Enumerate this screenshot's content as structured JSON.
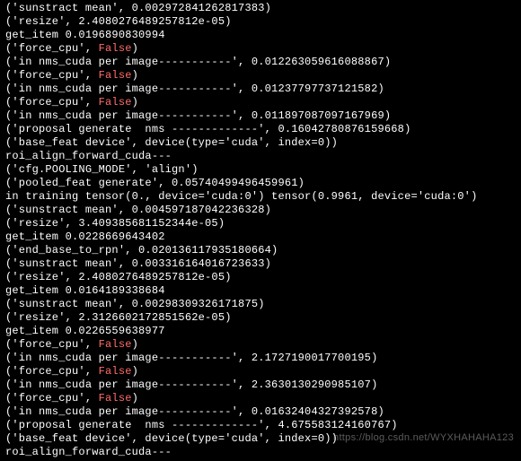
{
  "terminal": {
    "lines": [
      {
        "id": "l01",
        "segments": [
          {
            "t": "('sunstract mean', 0.002972841262817383)"
          }
        ]
      },
      {
        "id": "l02",
        "segments": [
          {
            "t": "('resize', 2.4080276489257812e-05)"
          }
        ]
      },
      {
        "id": "l03",
        "segments": [
          {
            "t": "get_item 0.0196890830994"
          }
        ]
      },
      {
        "id": "l04",
        "segments": [
          {
            "t": "('force_cpu', "
          },
          {
            "t": "False",
            "cls": "false-val"
          },
          {
            "t": ")"
          }
        ]
      },
      {
        "id": "l05",
        "segments": [
          {
            "t": "('in nms_cuda per image-----------', 0.012263059616088867)"
          }
        ]
      },
      {
        "id": "l06",
        "segments": [
          {
            "t": "('force_cpu', "
          },
          {
            "t": "False",
            "cls": "false-val"
          },
          {
            "t": ")"
          }
        ]
      },
      {
        "id": "l07",
        "segments": [
          {
            "t": "('in nms_cuda per image-----------', 0.01237797737121582)"
          }
        ]
      },
      {
        "id": "l08",
        "segments": [
          {
            "t": "('force_cpu', "
          },
          {
            "t": "False",
            "cls": "false-val"
          },
          {
            "t": ")"
          }
        ]
      },
      {
        "id": "l09",
        "segments": [
          {
            "t": "('in nms_cuda per image-----------', 0.011897087097167969)"
          }
        ]
      },
      {
        "id": "l10",
        "segments": [
          {
            "t": "('proposal generate  nms -------------', 0.16042780876159668)"
          }
        ]
      },
      {
        "id": "l11",
        "segments": [
          {
            "t": "('base_feat device', device(type='cuda', index=0))"
          }
        ]
      },
      {
        "id": "l12",
        "segments": [
          {
            "t": "roi_align_forward_cuda---"
          }
        ]
      },
      {
        "id": "l13",
        "segments": [
          {
            "t": "('cfg.POOLING_MODE', 'align')"
          }
        ]
      },
      {
        "id": "l14",
        "segments": [
          {
            "t": "('pooled_feat generate', 0.05740499496459961)"
          }
        ]
      },
      {
        "id": "l15",
        "segments": [
          {
            "t": "in training tensor(0., device='cuda:0') tensor(0.9961, device='cuda:0')"
          }
        ]
      },
      {
        "id": "l16",
        "segments": [
          {
            "t": "('sunstract mean', 0.004597187042236328)"
          }
        ]
      },
      {
        "id": "l17",
        "segments": [
          {
            "t": "('resize', 3.409385681152344e-05)"
          }
        ]
      },
      {
        "id": "l18",
        "segments": [
          {
            "t": "get_item 0.0228669643402"
          }
        ]
      },
      {
        "id": "l19",
        "segments": [
          {
            "t": "('end_base_to_rpn', 0.020136117935180664)"
          }
        ]
      },
      {
        "id": "l20",
        "segments": [
          {
            "t": "('sunstract mean', 0.003316164016723633)"
          }
        ]
      },
      {
        "id": "l21",
        "segments": [
          {
            "t": "('resize', 2.4080276489257812e-05)"
          }
        ]
      },
      {
        "id": "l22",
        "segments": [
          {
            "t": "get_item 0.0164189338684"
          }
        ]
      },
      {
        "id": "l23",
        "segments": [
          {
            "t": "('sunstract mean', 0.00298309326171875)"
          }
        ]
      },
      {
        "id": "l24",
        "segments": [
          {
            "t": "('resize', 2.3126602172851562e-05)"
          }
        ]
      },
      {
        "id": "l25",
        "segments": [
          {
            "t": "get_item 0.0226559638977"
          }
        ]
      },
      {
        "id": "l26",
        "segments": [
          {
            "t": "('force_cpu', "
          },
          {
            "t": "False",
            "cls": "false-val"
          },
          {
            "t": ")"
          }
        ]
      },
      {
        "id": "l27",
        "segments": [
          {
            "t": "('in nms_cuda per image-----------', 2.1727190017700195)"
          }
        ]
      },
      {
        "id": "l28",
        "segments": [
          {
            "t": "('force_cpu', "
          },
          {
            "t": "False",
            "cls": "false-val"
          },
          {
            "t": ")"
          }
        ]
      },
      {
        "id": "l29",
        "segments": [
          {
            "t": "('in nms_cuda per image-----------', 2.3630130290985107)"
          }
        ]
      },
      {
        "id": "l30",
        "segments": [
          {
            "t": "('force_cpu', "
          },
          {
            "t": "False",
            "cls": "false-val"
          },
          {
            "t": ")"
          }
        ]
      },
      {
        "id": "l31",
        "segments": [
          {
            "t": "('in nms_cuda per image-----------', 0.01632404327392578)"
          }
        ]
      },
      {
        "id": "l32",
        "segments": [
          {
            "t": "('proposal generate  nms -------------', 4.675583124160767)"
          }
        ]
      },
      {
        "id": "l33",
        "segments": [
          {
            "t": "('base_feat device', device(type='cuda', index=0))"
          }
        ]
      },
      {
        "id": "l34",
        "segments": [
          {
            "t": "roi_align_forward_cuda---"
          }
        ]
      }
    ]
  },
  "watermark": {
    "text": "https://blog.csdn.net/WYXHAHAHA123"
  }
}
